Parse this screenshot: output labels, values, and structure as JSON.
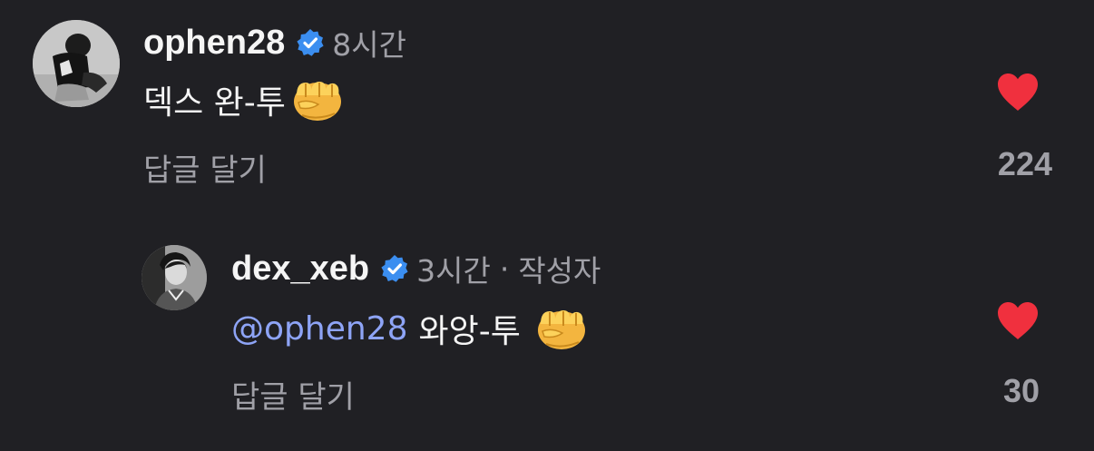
{
  "comments": [
    {
      "username": "ophen28",
      "verified_icon": "verified-badge-icon",
      "time": "8시간",
      "text": "덱스 완-투",
      "emoji": "fist-emoji",
      "reply_label": "답글 달기",
      "like_icon": "heart-icon",
      "liked": true,
      "like_count": "224"
    },
    {
      "username": "dex_xeb",
      "verified_icon": "verified-badge-icon",
      "time": "3시간",
      "separator": "·",
      "author_badge": "작성자",
      "mention": "@ophen28",
      "text": "와앙-투",
      "emoji": "fist-emoji",
      "reply_label": "답글 달기",
      "like_icon": "heart-icon",
      "liked": true,
      "like_count": "30"
    }
  ],
  "colors": {
    "background": "#202024",
    "text_primary": "#f5f5f5",
    "text_secondary": "#a0a0a7",
    "mention": "#8ea4f6",
    "verified": "#3b8ef0",
    "heart": "#f0303e"
  }
}
